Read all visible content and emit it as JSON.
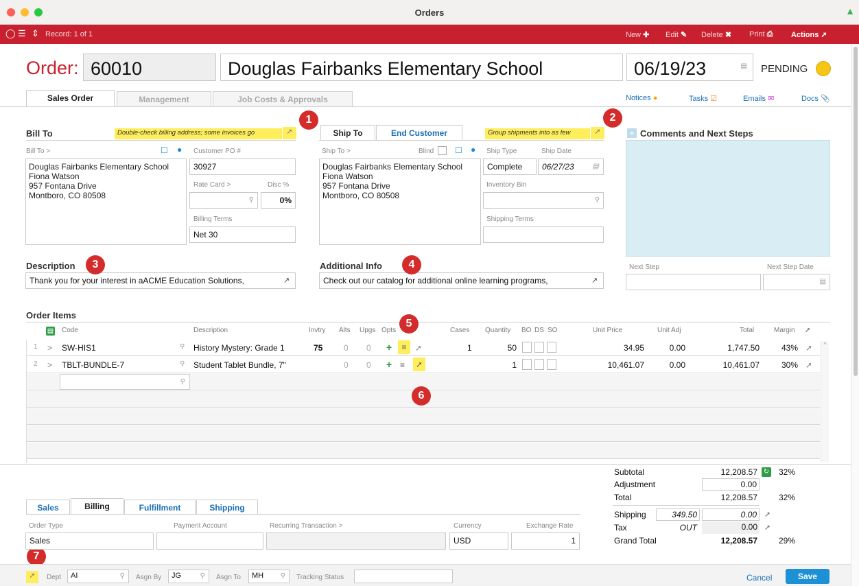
{
  "window": {
    "title": "Orders"
  },
  "toolbar": {
    "record": "Record: 1 of 1",
    "new": "New",
    "edit": "Edit",
    "delete": "Delete",
    "print": "Print",
    "actions": "Actions"
  },
  "header": {
    "order_label": "Order:",
    "order_no": "60010",
    "customer": "Douglas Fairbanks Elementary School",
    "date": "06/19/23",
    "status": "PENDING",
    "status_color": "#f7c516"
  },
  "tabs": [
    "Sales Order",
    "Management",
    "Job Costs & Approvals"
  ],
  "quicklinks": {
    "notices": "Notices",
    "tasks": "Tasks",
    "emails": "Emails",
    "docs": "Docs"
  },
  "bill": {
    "title": "Bill To",
    "note": "Double-check billing address; some invoices go",
    "bill_to_label": "Bill To >",
    "address": [
      "Douglas Fairbanks Elementary School",
      "Fiona Watson",
      "957 Fontana Drive",
      "Montboro, CO 80508"
    ],
    "po_label": "Customer PO #",
    "po": "30927",
    "rate_label": "Rate Card >",
    "disc_label": "Disc %",
    "disc": "0%",
    "terms_label": "Billing Terms",
    "terms": "Net 30"
  },
  "ship": {
    "tab_ship": "Ship To",
    "tab_end": "End Customer",
    "note": "Group shipments into as few",
    "ship_to_label": "Ship To >",
    "blind": "Blind",
    "address": [
      "Douglas Fairbanks Elementary School",
      "Fiona Watson",
      "957 Fontana Drive",
      "Montboro, CO 80508"
    ],
    "type_label": "Ship Type",
    "type": "Complete",
    "date_label": "Ship Date",
    "date": "06/27/23",
    "bin_label": "Inventory Bin",
    "terms_label": "Shipping Terms"
  },
  "comments": {
    "title": "Comments and Next Steps",
    "next_step": "Next Step",
    "next_step_date": "Next Step Date"
  },
  "description": {
    "title": "Description",
    "text": "Thank you for your interest in aACME Education Solutions,"
  },
  "additional": {
    "title": "Additional Info",
    "text": "Check out our catalog for additional online learning programs,"
  },
  "badges": [
    "1",
    "2",
    "3",
    "4",
    "5",
    "6",
    "7"
  ],
  "items": {
    "title": "Order Items",
    "headers": {
      "code": "Code",
      "description": "Description",
      "invtry": "Invtry",
      "alts": "Alts",
      "upgs": "Upgs",
      "opts": "Opts",
      "cases": "Cases",
      "quantity": "Quantity",
      "bo": "BO",
      "ds": "DS",
      "so": "SO",
      "unit_price": "Unit Price",
      "unit_adj": "Unit Adj",
      "total": "Total",
      "margin": "Margin"
    },
    "rows": [
      {
        "n": "1",
        "code": "SW-HIS1",
        "desc": "History Mystery: Grade 1",
        "invtry": "75",
        "alts": "0",
        "upgs": "0",
        "cases": "1",
        "qty": "50",
        "price": "34.95",
        "adj": "0.00",
        "total": "1,747.50",
        "margin": "43%"
      },
      {
        "n": "2",
        "code": "TBLT-BUNDLE-7",
        "desc": "Student Tablet Bundle, 7\"",
        "invtry": "",
        "alts": "0",
        "upgs": "0",
        "cases": "",
        "qty": "1",
        "price": "10,461.07",
        "adj": "0.00",
        "total": "10,461.07",
        "margin": "30%"
      }
    ]
  },
  "bottom_tabs": [
    "Sales",
    "Billing",
    "Fulfillment",
    "Shipping"
  ],
  "billing": {
    "order_type_label": "Order Type",
    "order_type": "Sales",
    "payment_label": "Payment Account",
    "recurring_label": "Recurring Transaction >",
    "currency_label": "Currency",
    "currency": "USD",
    "exchange_label": "Exchange Rate",
    "exchange": "1"
  },
  "totals": {
    "subtotal_label": "Subtotal",
    "subtotal": "12,208.57",
    "subtotal_pct": "32%",
    "adjustment_label": "Adjustment",
    "adjustment": "0.00",
    "total_label": "Total",
    "total": "12,208.57",
    "total_pct": "32%",
    "shipping_label": "Shipping",
    "shipping_cost": "349.50",
    "shipping": "0.00",
    "tax_label": "Tax",
    "tax_code": "OUT",
    "tax": "0.00",
    "grand_label": "Grand Total",
    "grand": "12,208.57",
    "grand_pct": "29%"
  },
  "footer": {
    "dept_label": "Dept",
    "dept": "AI",
    "asgn_by_label": "Asgn By",
    "asgn_by": "JG",
    "asgn_to_label": "Asgn To",
    "asgn_to": "MH",
    "tracking_label": "Tracking Status",
    "cancel": "Cancel",
    "save": "Save"
  }
}
